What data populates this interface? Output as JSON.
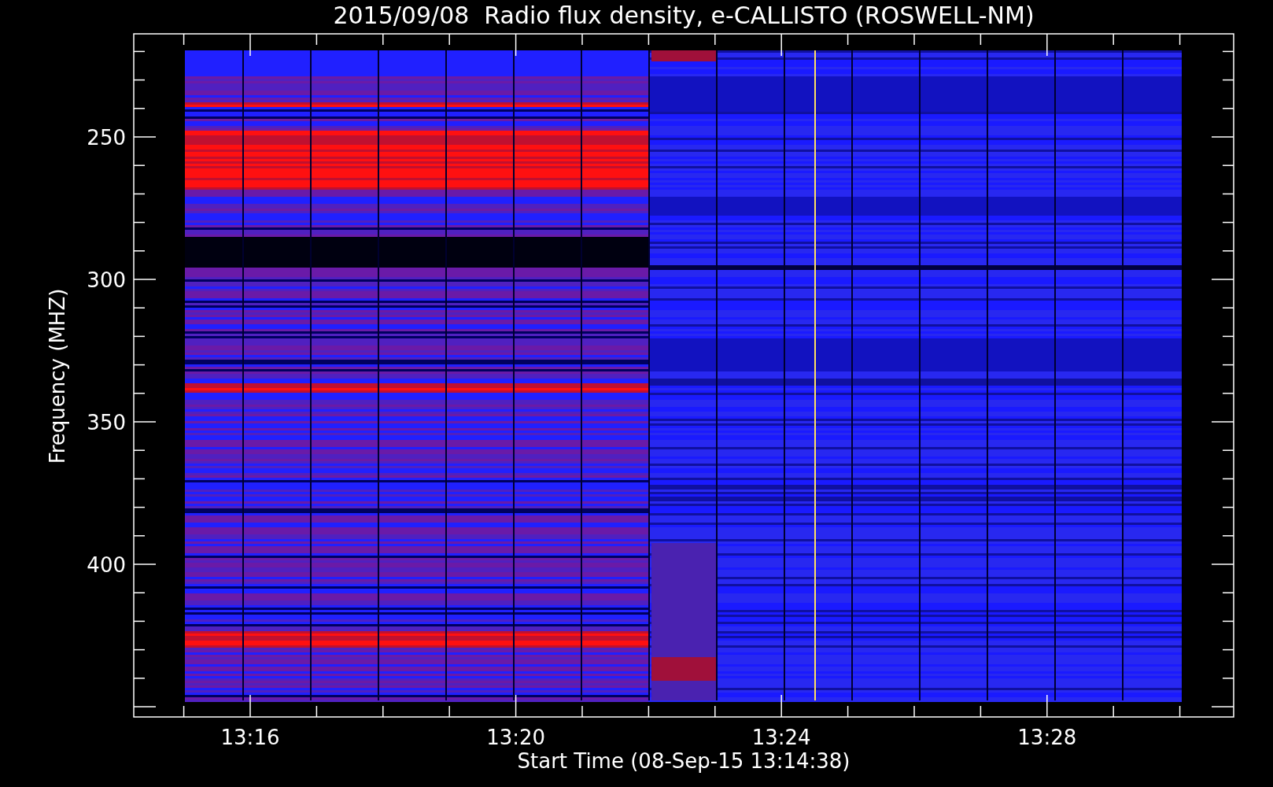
{
  "title": "2015/09/08  Radio flux density, e-CALLISTO (ROSWELL-NM)",
  "plot": {
    "ylabel": "Frequency (MHZ)",
    "xlabel": "Start Time (08-Sep-15 13:14:38)",
    "yticks": [
      "250",
      "300",
      "350",
      "400"
    ],
    "xticks": [
      "13:16",
      "13:20",
      "13:24",
      "13:28"
    ]
  }
}
